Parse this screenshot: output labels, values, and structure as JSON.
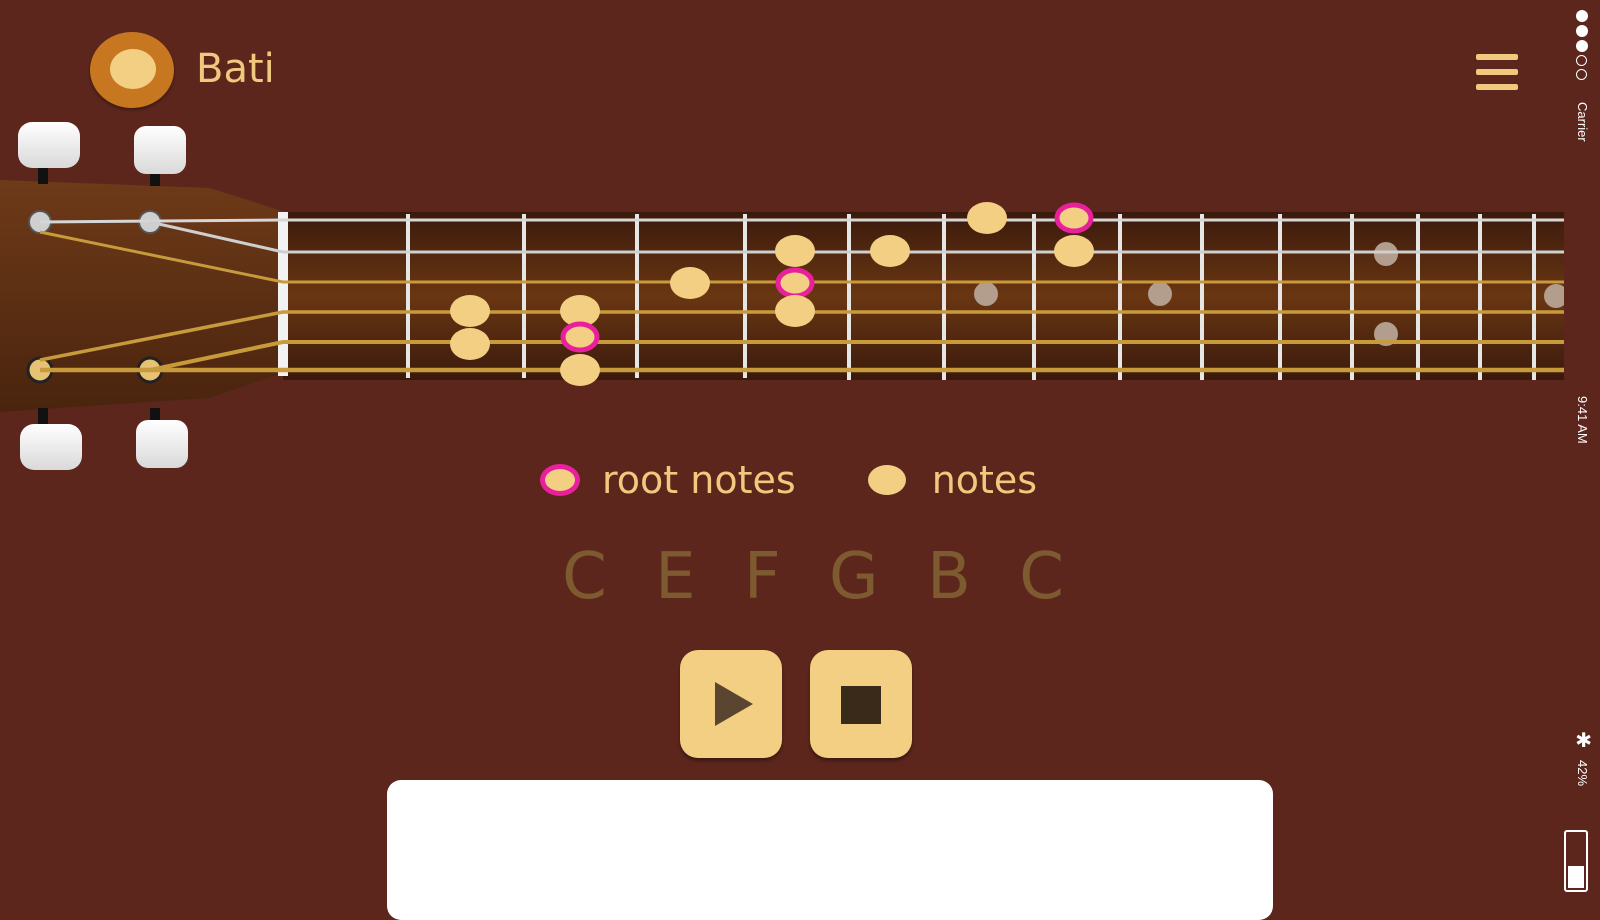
{
  "app": {
    "title": "Bati"
  },
  "legend": {
    "root_label": "root notes",
    "notes_label": "notes"
  },
  "scale": {
    "notes": "C E F G B C"
  },
  "colors": {
    "background": "#5c261c",
    "accent": "#f0c87e",
    "note": "#f3cf84",
    "root_ring": "#e8209c",
    "scale_text": "#7e5a30"
  },
  "icons": {
    "menu": "hamburger-menu-icon",
    "play": "play-icon",
    "stop": "stop-icon"
  },
  "status_bar": {
    "carrier": "Carrier",
    "time": "9:41 AM",
    "battery": "42%"
  },
  "fretboard": {
    "strings": 6,
    "frets": 14,
    "scale_notes": [
      {
        "string": 1,
        "fret": 7,
        "root": false
      },
      {
        "string": 1,
        "fret": 8,
        "root": true
      },
      {
        "string": 2,
        "fret": 5,
        "root": false
      },
      {
        "string": 2,
        "fret": 6,
        "root": false
      },
      {
        "string": 2,
        "fret": 8,
        "root": false
      },
      {
        "string": 3,
        "fret": 4,
        "root": false
      },
      {
        "string": 3,
        "fret": 5,
        "root": true
      },
      {
        "string": 4,
        "fret": 2,
        "root": false
      },
      {
        "string": 4,
        "fret": 3,
        "root": false
      },
      {
        "string": 4,
        "fret": 5,
        "root": false
      },
      {
        "string": 5,
        "fret": 2,
        "root": false
      },
      {
        "string": 5,
        "fret": 3,
        "root": true
      },
      {
        "string": 6,
        "fret": 3,
        "root": false
      }
    ]
  }
}
